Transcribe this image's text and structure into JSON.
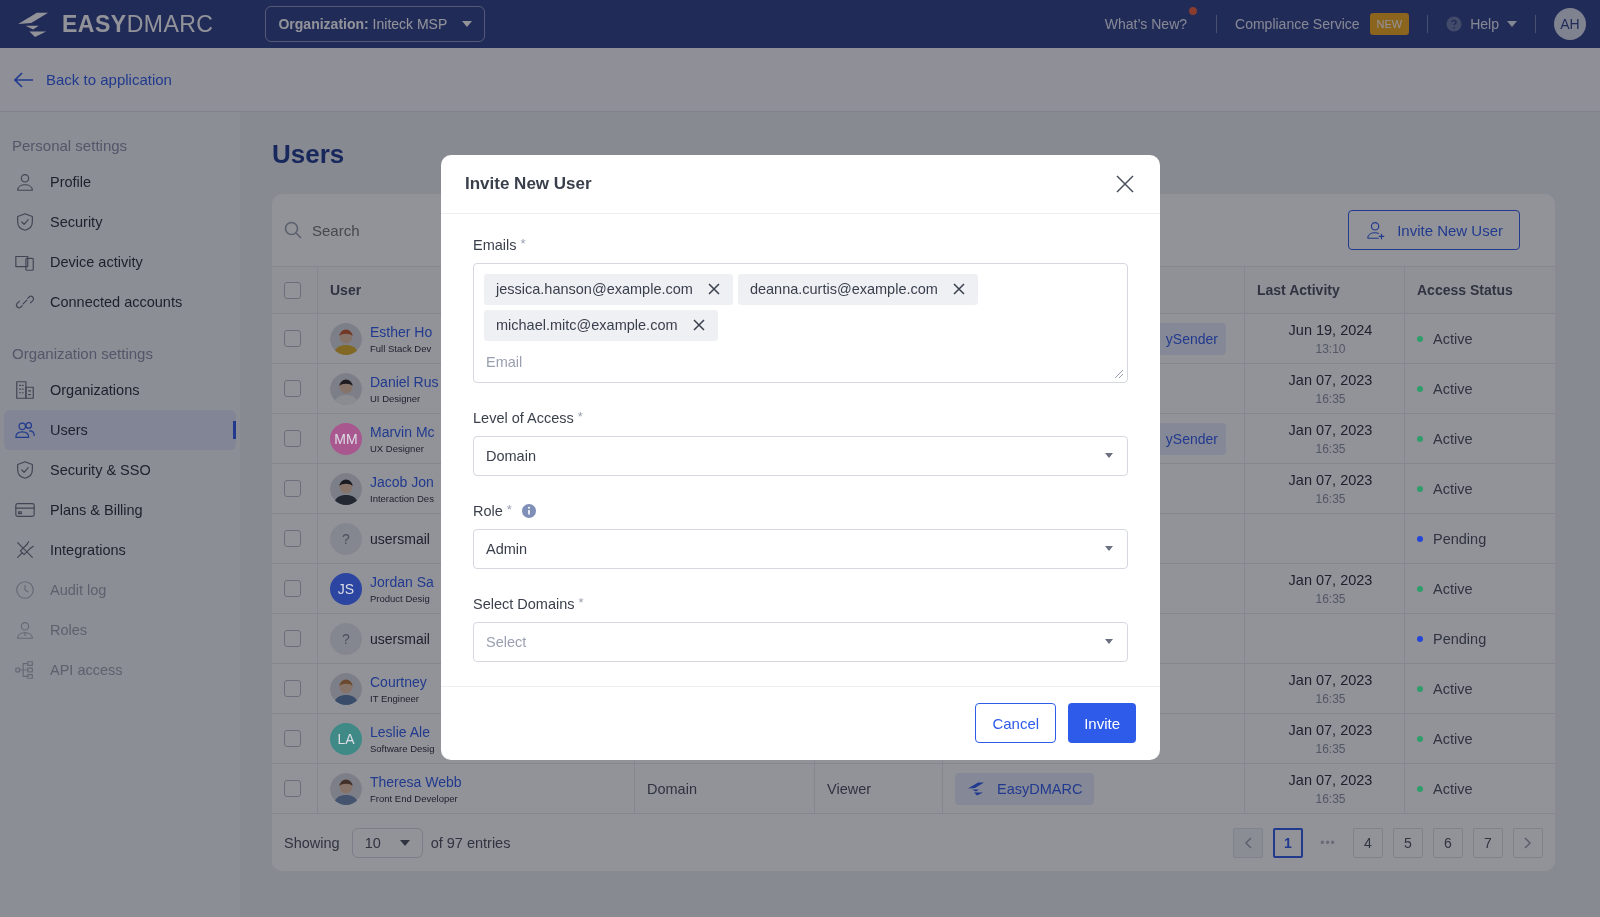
{
  "header": {
    "logo": "**EASY**DMARC",
    "organization": "**Organization:** Initeck MSP",
    "whats_new": {
      "label": "What’s New?",
      "notification": true
    },
    "compliance": {
      "label": "Compliance Service",
      "badge": "NEW"
    },
    "help": "Help",
    "avatar": "AH"
  },
  "back_link": "Back to application",
  "sidebar": {
    "sections": [
      {
        "title": "Personal settings",
        "items": [
          {
            "label": "Profile",
            "selected": false,
            "disabled": false
          },
          {
            "label": "Security",
            "selected": false,
            "disabled": false
          },
          {
            "label": "Device activity",
            "selected": false,
            "disabled": false
          },
          {
            "label": "Connected accounts",
            "selected": false,
            "disabled": false
          }
        ]
      },
      {
        "title": "Organization settings",
        "items": [
          {
            "label": "Organizations",
            "selected": false,
            "disabled": false
          },
          {
            "label": "Users",
            "selected": true,
            "disabled": false
          },
          {
            "label": "Security & SSO",
            "selected": false,
            "disabled": false
          },
          {
            "label": "Plans & Billing",
            "selected": false,
            "disabled": false
          },
          {
            "label": "Integrations",
            "selected": false,
            "disabled": false
          },
          {
            "label": "Audit log",
            "selected": false,
            "disabled": true
          },
          {
            "label": "Roles",
            "selected": false,
            "disabled": true
          },
          {
            "label": "API access",
            "selected": false,
            "disabled": true
          }
        ]
      }
    ]
  },
  "page_title": "Users",
  "search": {
    "placeholder": "Search"
  },
  "invite_button": "Invite New User",
  "table": {
    "columns": {
      "user": "User",
      "last_activity": "Last Activity",
      "access_status": "Access Status"
    },
    "header_checked": false,
    "rows": [
      {
        "checked": false,
        "kind": "user",
        "name": "Esther Ho",
        "subtitle": "Full Stack Dev",
        "tool": "ySender",
        "date": "Jun 19, 2024",
        "time": "13:10",
        "status": "Active",
        "color": "#2e9e6a"
      },
      {
        "checked": false,
        "kind": "user",
        "name": "Daniel Rus",
        "subtitle": "UI Designer",
        "date": "Jan 07, 2023",
        "time": "16:35",
        "status": "Active",
        "color": "#2e9e6a"
      },
      {
        "checked": false,
        "kind": "user",
        "avatar": {
          "kind": "initials",
          "text": "MM",
          "color": "#a8578f"
        },
        "name": "Marvin Mc",
        "subtitle": "UX Designer",
        "tool": "ySender",
        "date": "Jan 07, 2023",
        "time": "16:35",
        "status": "Active",
        "color": "#2e9e6a"
      },
      {
        "checked": false,
        "kind": "user",
        "name": "Jacob Jon",
        "subtitle": "Interaction Des",
        "date": "Jan 07, 2023",
        "time": "16:35",
        "status": "Active",
        "color": "#2e9e6a"
      },
      {
        "checked": false,
        "kind": "invite",
        "avatar": {
          "kind": "unknown",
          "text": "?"
        },
        "name": "usersmail",
        "status": "Pending",
        "color": "#2446d8"
      },
      {
        "checked": false,
        "kind": "user",
        "avatar": {
          "kind": "initials",
          "text": "JS",
          "color": "#2c45a0"
        },
        "name": "Jordan Sa",
        "subtitle": "Product Desig",
        "date": "Jan 07, 2023",
        "time": "16:35",
        "status": "Active",
        "color": "#2e9e6a"
      },
      {
        "checked": false,
        "kind": "invite",
        "avatar": {
          "kind": "unknown",
          "text": "?"
        },
        "name": "usersmail",
        "status": "Pending",
        "color": "#2446d8"
      },
      {
        "checked": false,
        "kind": "user",
        "name": "Courtney",
        "subtitle": "IT Engineer",
        "date": "Jan 07, 2023",
        "time": "16:35",
        "status": "Active",
        "color": "#2e9e6a"
      },
      {
        "checked": false,
        "kind": "user",
        "avatar": {
          "kind": "initials",
          "text": "LA",
          "color": "#3f8a87"
        },
        "name": "Leslie Ale",
        "subtitle": "Software Desig",
        "date": "Jan 07, 2023",
        "time": "16:35",
        "status": "Active",
        "color": "#2e9e6a"
      },
      {
        "checked": false,
        "kind": "user",
        "name": "Theresa Webb",
        "subtitle": "Front End Developer",
        "level": "Domain",
        "role": "Viewer",
        "tool": "EasyDMARC",
        "date": "Jan 07, 2023",
        "time": "16:35",
        "status": "Active",
        "color": "#2e9e6a"
      }
    ]
  },
  "footer": {
    "showing": "Showing",
    "page_size": "10",
    "total": "of 97 entries",
    "pages": [
      {
        "label": "1",
        "kind": "page",
        "selected": true
      },
      {
        "label": "•••",
        "kind": "ellipsis"
      },
      {
        "label": "4",
        "kind": "page",
        "selected": false
      },
      {
        "label": "5",
        "kind": "page",
        "selected": false
      },
      {
        "label": "6",
        "kind": "page",
        "selected": false
      },
      {
        "label": "7",
        "kind": "page",
        "selected": false
      }
    ]
  },
  "modal": {
    "title": "Invite New User",
    "emails": {
      "label": "Emails",
      "asterisk": "*",
      "chips": [
        "jessica.hanson@example.com",
        "deanna.curtis@example.com",
        "michael.mitc@example.com"
      ],
      "placeholder": "Email"
    },
    "fields": [
      {
        "label": "Level of Access",
        "asterisk": "*",
        "info_icon": false,
        "value": "Domain"
      },
      {
        "label": "Role",
        "asterisk": "*",
        "info_icon": true,
        "value": "Admin"
      },
      {
        "label": "Select Domains",
        "asterisk": "*",
        "info_icon": false,
        "placeholder": "Select"
      }
    ],
    "buttons": [
      {
        "label": "Cancel",
        "kind": "secondary"
      },
      {
        "label": "Invite",
        "kind": "primary"
      }
    ]
  }
}
